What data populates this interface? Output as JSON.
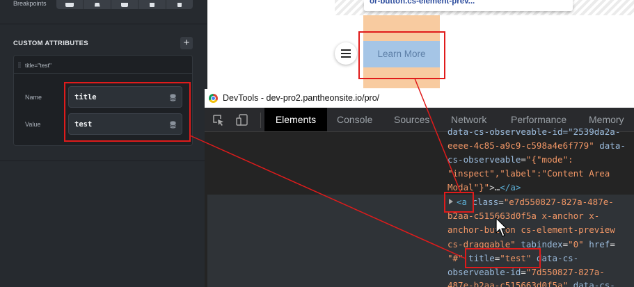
{
  "left_panel": {
    "breakpoints_label": "Breakpoints",
    "breakpoint_icons": [
      "desktop-icon",
      "laptop-icon",
      "tablet-landscape-icon",
      "tablet-icon",
      "phone-icon"
    ],
    "custom_attributes": {
      "header": "CUSTOM ATTRIBUTES",
      "add_glyph": "+",
      "attribute_summary": "title=\"test\"",
      "name_label": "Name",
      "name_value": "title",
      "value_label": "Value",
      "value_value": "test"
    }
  },
  "preview": {
    "tooltip_text": "or-button.cs-element-prev...",
    "button_label": "Learn More",
    "menu_icon": "hamburger-icon"
  },
  "devtools": {
    "window_title": "DevTools - dev-pro2.pantheonsite.io/pro/",
    "tabs": [
      "Elements",
      "Console",
      "Sources",
      "Network",
      "Performance",
      "Memory"
    ],
    "active_tab": "Elements",
    "code": {
      "l1": "data-cs-observeable-id=\"2539da2a-",
      "l2a": "eeee-4c85-a9c9-c598a4e6f779\"",
      "l2b": " data-",
      "l3a": "cs-observeable",
      "l3b": "=",
      "l3c": "\"{\"mode\":",
      "l4": "\"inspect\",\"label\":\"Content Area",
      "l5a": "Modal\"}\"",
      "l5b": ">…",
      "l5c": "</a>",
      "l6a": "<a",
      "l6b": " class",
      "l6c": "=",
      "l6d": "\"e7d550827-827a-487e-",
      "l7": "b2aa-c515663d0f5a x-anchor x-",
      "l8": "anchor-button cs-element-preview",
      "l9a": "cs-draggable\"",
      "l9b": " tabindex",
      "l9c": "=",
      "l9d": "\"0\"",
      "l9e": " href",
      "l9f": "=",
      "l10a": "\"#\"",
      "l10b": " title",
      "l10c": "=",
      "l10d": "\"test\"",
      "l10e": " data-cs-",
      "l11a": "observeable-id",
      "l11b": "=",
      "l11c": "\"7d550827-827a-",
      "l12a": "487e-b2aa-c515663d0f5a\"",
      "l12b": " data-cs-"
    }
  },
  "colors": {
    "annotation_red": "#e01b1b",
    "attr_name": "#9bbbdc",
    "attr_value": "#f29766",
    "tag": "#5db0d7"
  }
}
